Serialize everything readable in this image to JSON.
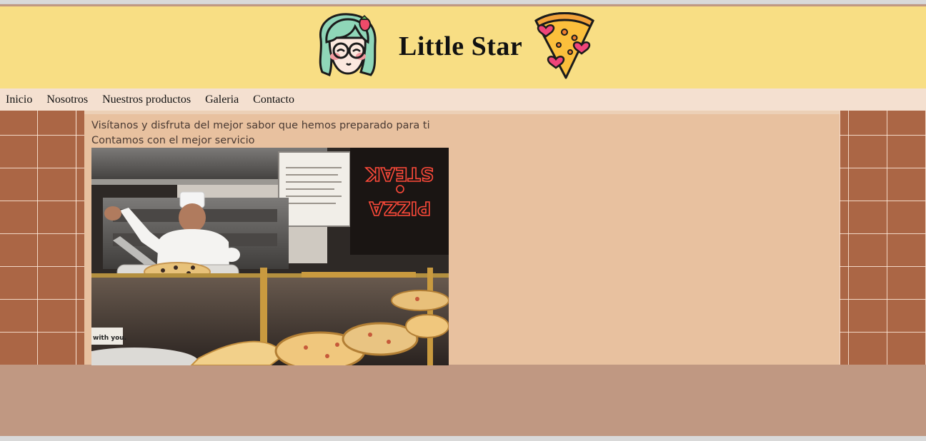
{
  "header": {
    "title": "Little Star"
  },
  "nav": {
    "items": [
      "Inicio",
      "Nosotros",
      "Nuestros productos",
      "Galeria",
      "Contacto"
    ]
  },
  "main": {
    "line1": "Visítanos y disfruta del mejor sabor que hemos preparado para ti",
    "line2": "Contamos con el mejor servicio"
  },
  "photo": {
    "sign_text": "STEAK & PIZZA",
    "sticker_text": "with you."
  },
  "colors": {
    "header_bg": "#f8de84",
    "nav_bg": "#f4e0d0",
    "main_bg": "#e8c19f",
    "tile": "#ab6645",
    "footer_bg": "#c09882"
  }
}
